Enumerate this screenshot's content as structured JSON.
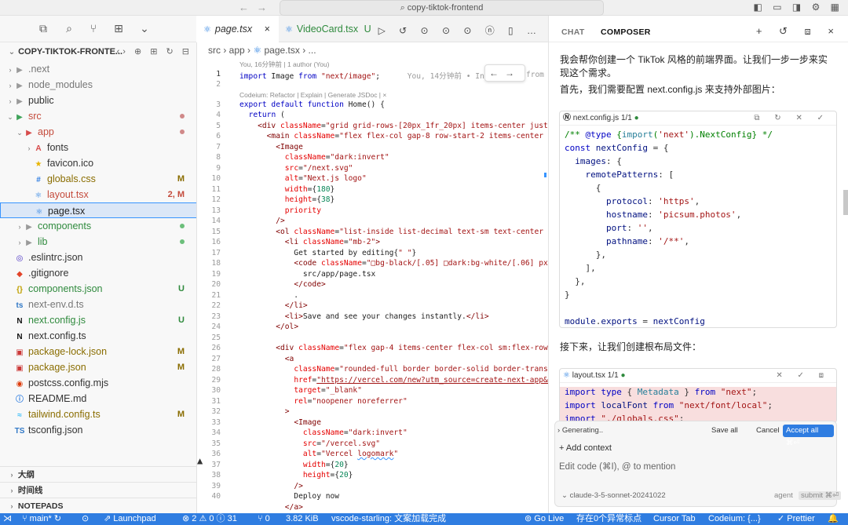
{
  "window": {
    "search_text": "copy-tiktok-frontend"
  },
  "explorer": {
    "title": "COPY-TIKTOK-FRONTE...",
    "items": [
      {
        "label": ".next",
        "color": "#777777",
        "icon": "folder",
        "twisty": "›"
      },
      {
        "label": "node_modules",
        "color": "#777777",
        "icon": "folder",
        "twisty": "›"
      },
      {
        "label": "public",
        "color": "#333333",
        "icon": "folder",
        "twisty": "›"
      },
      {
        "label": "src",
        "color": "#c44b3c",
        "icon": "folder-src",
        "twisty": "⌄",
        "dot": "#d08989"
      },
      {
        "label": "app",
        "color": "#c44b3c",
        "icon": "folder-app",
        "twisty": "⌄",
        "dot": "#d08989"
      },
      {
        "label": "fonts",
        "color": "#333333",
        "icon": "folder-font",
        "twisty": "›"
      },
      {
        "label": "favicon.ico",
        "color": "#333333",
        "icon": "star-icon"
      },
      {
        "label": "globals.css",
        "color": "#8a6d00",
        "icon": "css-icon",
        "badge": "M",
        "badge_color": "#8a6d00"
      },
      {
        "label": "layout.tsx",
        "color": "#c44b3c",
        "icon": "react-icon",
        "badge": "2, M",
        "badge_color": "#c44b3c"
      },
      {
        "label": "page.tsx",
        "color": "#222222",
        "icon": "react-icon",
        "selected": true
      },
      {
        "label": "components",
        "color": "#2f8a3d",
        "icon": "folder",
        "twisty": "›",
        "dot": "#6cbf7b"
      },
      {
        "label": "lib",
        "color": "#2f8a3d",
        "icon": "folder",
        "twisty": "›",
        "dot": "#6cbf7b"
      },
      {
        "label": ".eslintrc.json",
        "color": "#333333",
        "icon": "eslint-icon"
      },
      {
        "label": ".gitignore",
        "color": "#333333",
        "icon": "git-icon"
      },
      {
        "label": "components.json",
        "color": "#2f8a3d",
        "icon": "json-icon",
        "badge": "U",
        "badge_color": "#2f8a3d"
      },
      {
        "label": "next-env.d.ts",
        "color": "#777777",
        "icon": "ts-icon"
      },
      {
        "label": "next.config.js",
        "color": "#2f8a3d",
        "icon": "next-icon",
        "badge": "U",
        "badge_color": "#2f8a3d"
      },
      {
        "label": "next.config.ts",
        "color": "#333333",
        "icon": "next-icon"
      },
      {
        "label": "package-lock.json",
        "color": "#8a6d00",
        "icon": "npm-icon",
        "badge": "M",
        "badge_color": "#8a6d00"
      },
      {
        "label": "package.json",
        "color": "#8a6d00",
        "icon": "npm-icon",
        "badge": "M",
        "badge_color": "#8a6d00"
      },
      {
        "label": "postcss.config.mjs",
        "color": "#333333",
        "icon": "postcss-icon"
      },
      {
        "label": "README.md",
        "color": "#333333",
        "icon": "info-icon"
      },
      {
        "label": "tailwind.config.ts",
        "color": "#8a6d00",
        "icon": "tailwind-icon",
        "badge": "M",
        "badge_color": "#8a6d00"
      },
      {
        "label": "tsconfig.json",
        "color": "#333333",
        "icon": "tsconfig-icon"
      }
    ],
    "sections": [
      "大纲",
      "时间线",
      "NOTEPADS"
    ]
  },
  "editor": {
    "tabs": [
      {
        "label": "page.tsx",
        "suffix": "×"
      },
      {
        "label": "VideoCard.tsx",
        "suffix": "U"
      }
    ],
    "breadcrumb": [
      "src",
      "app",
      "page.tsx",
      "..."
    ],
    "blame": "You, 16分钟前 | 1 author (You)",
    "ghost_text": "You, 14分钟前 • Initi",
    "ghost_tail": "from",
    "codelens": "Codeium: Refactor | Explain | Generate JSDoc | ×",
    "line_numbers": [
      "1",
      "2",
      "3",
      "4",
      "5",
      "6",
      "7",
      "8",
      "9",
      "10",
      "11",
      "12",
      "13",
      "14",
      "15",
      "16",
      "17",
      "18",
      "19",
      "20",
      "21",
      "22",
      "23",
      "24",
      "25",
      "26",
      "27",
      "28",
      "29",
      "30",
      "31",
      "32",
      "33",
      "34",
      "35",
      "36",
      "37",
      "38",
      "39",
      "40"
    ]
  },
  "chat": {
    "tabs": [
      "CHAT",
      "COMPOSER"
    ],
    "intro": "我会帮你创建一个 TikTok 风格的前端界面。让我们一步一步来实现这个需求。",
    "step1": "首先，我们需要配置 next.config.js 来支持外部图片：",
    "block1": {
      "file": "next.config.js",
      "count": "1/1"
    },
    "step2": "接下来，让我们创建根布局文件：",
    "block2": {
      "file": "layout.tsx",
      "count": "1/1"
    },
    "generating": "Generating..",
    "save_all": "Save all",
    "cancel": "Cancel",
    "accept_all": "Accept all ⌘⏎",
    "add_context": "+ Add context",
    "placeholder": "Edit code (⌘I), @ to mention",
    "model": "claude-3-5-sonnet-20241022",
    "agent": "agent",
    "submit": "submit ⌘⏎"
  },
  "statusbar": {
    "branch": "main*",
    "launchpad": "Launchpad",
    "problems": "⊗ 2 ⚠ 0 ⓘ 31",
    "ports": "⑂ 0",
    "size": "3.82 KiB",
    "starling": "vscode-starling: 文案加载完成",
    "golive": "Go Live",
    "exceptions": "存在0个异常标点",
    "cursor_tab": "Cursor Tab",
    "codeium": "Codeium: {...}",
    "prettier": "✓ Prettier"
  }
}
